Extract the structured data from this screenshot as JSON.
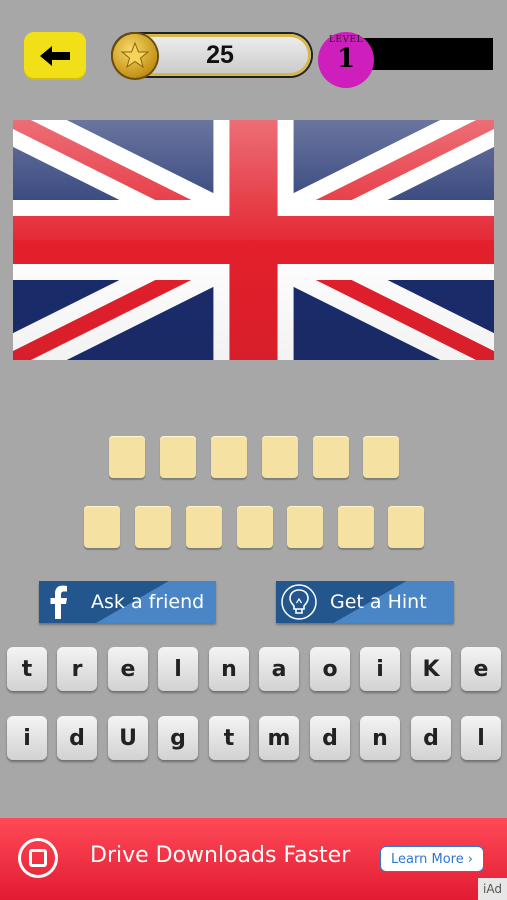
{
  "header": {
    "coins": "25",
    "level_label": "LEVEL",
    "level_number": "1"
  },
  "puzzle": {
    "image_icon": "union-jack-flag",
    "answer_rows": [
      6,
      7
    ]
  },
  "actions": {
    "ask_friend_label": "Ask a friend",
    "hint_label": "Get a Hint"
  },
  "keyboard": {
    "row1": [
      "t",
      "r",
      "e",
      "l",
      "n",
      "a",
      "o",
      "i",
      "K",
      "e"
    ],
    "row2": [
      "i",
      "d",
      "U",
      "g",
      "t",
      "m",
      "d",
      "n",
      "d",
      "l"
    ]
  },
  "ad": {
    "text": "Drive Downloads Faster",
    "button_label": "Learn More",
    "corner_label": "iAd"
  },
  "colors": {
    "background": "#a7a7a7",
    "back_button": "#f1df18",
    "level_badge": "#ce1ebc",
    "tile": "#f5e2a2",
    "ad_red": "#e21b32",
    "flag_blue": "#1a2c6b",
    "flag_red": "#e3202c"
  }
}
